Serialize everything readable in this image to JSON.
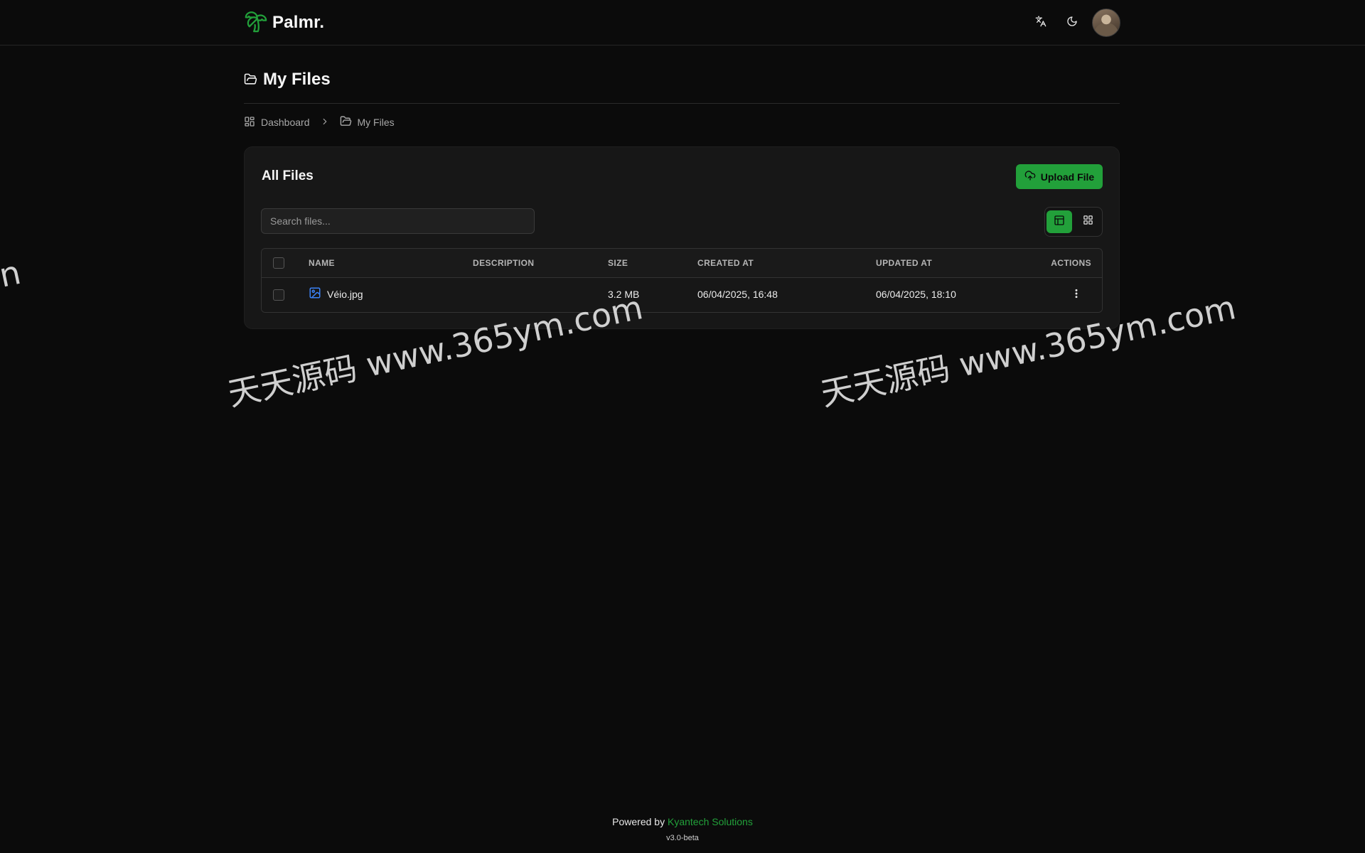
{
  "app": {
    "name": "Palmr."
  },
  "page": {
    "title": "My Files"
  },
  "breadcrumb": [
    {
      "label": "Dashboard"
    },
    {
      "label": "My Files"
    }
  ],
  "card": {
    "title": "All Files",
    "upload_label": "Upload File",
    "search_placeholder": "Search files..."
  },
  "table": {
    "columns": [
      "NAME",
      "DESCRIPTION",
      "SIZE",
      "CREATED AT",
      "UPDATED AT",
      "ACTIONS"
    ],
    "rows": [
      {
        "name": "Véio.jpg",
        "description": "",
        "size": "3.2 MB",
        "created_at": "06/04/2025, 16:48",
        "updated_at": "06/04/2025, 18:10"
      }
    ]
  },
  "watermark": {
    "text": "天天源码 www.365ym.com",
    "edge_fragment": "n"
  },
  "footer": {
    "powered_by": "Powered by",
    "company": "Kyantech Solutions",
    "version": "v3.0-beta"
  },
  "colors": {
    "accent": "#22a03a",
    "background": "#0b0b0b",
    "card": "#171717",
    "file_icon": "#3b82f6"
  },
  "icons": {
    "logo": "palm-tree-icon",
    "language": "translate-icon",
    "theme": "moon-icon",
    "page_title": "folder-open-icon",
    "dashboard": "layout-dashboard-icon",
    "upload": "cloud-upload-icon",
    "table_view": "table-icon",
    "grid_view": "grid-icon",
    "file": "image-file-icon",
    "actions": "more-vertical-icon"
  }
}
